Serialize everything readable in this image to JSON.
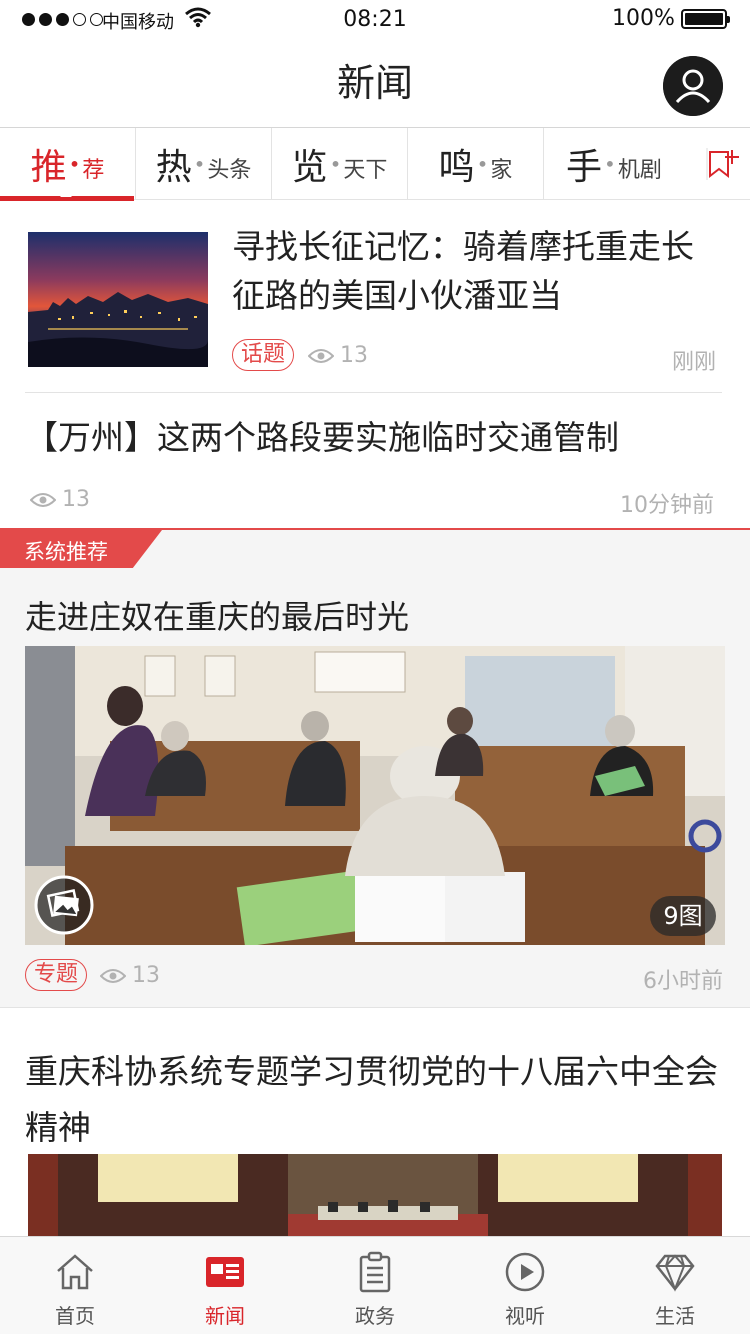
{
  "status_bar": {
    "carrier": "中国移动",
    "time": "08:21",
    "battery": "100%"
  },
  "header": {
    "title": "新闻"
  },
  "tabs": [
    {
      "big": "推",
      "small": "荐",
      "active": true
    },
    {
      "big": "热",
      "small": "头条",
      "active": false
    },
    {
      "big": "览",
      "small": "天下",
      "active": false
    },
    {
      "big": "鸣",
      "small": "家",
      "active": false
    },
    {
      "big": "手",
      "small": "机剧",
      "active": false
    }
  ],
  "tab_separator": "•",
  "articles": [
    {
      "title": "寻找长征记忆：骑着摩托重走长征路的美国小伙潘亚当",
      "tag": "话题",
      "views": "13",
      "time": "刚刚"
    },
    {
      "title": "【万州】这两个路段要实施临时交通管制",
      "views": "13",
      "time": "10分钟前"
    }
  ],
  "section": {
    "ribbon": "系统推荐",
    "title": "走进庄奴在重庆的最后时光",
    "photo_count": "9图",
    "tag": "专题",
    "views": "13",
    "time": "6小时前"
  },
  "article4": {
    "title": "重庆科协系统专题学习贯彻党的十八届六中全会精神"
  },
  "bottom_nav": [
    {
      "label": "首页",
      "icon": "home-icon",
      "active": false
    },
    {
      "label": "新闻",
      "icon": "news-icon",
      "active": true
    },
    {
      "label": "政务",
      "icon": "clipboard-icon",
      "active": false
    },
    {
      "label": "视听",
      "icon": "play-icon",
      "active": false
    },
    {
      "label": "生活",
      "icon": "diamond-icon",
      "active": false
    }
  ],
  "colors": {
    "accent": "#d9252a",
    "tag": "#e34a4a",
    "muted": "#b2b2b2"
  }
}
